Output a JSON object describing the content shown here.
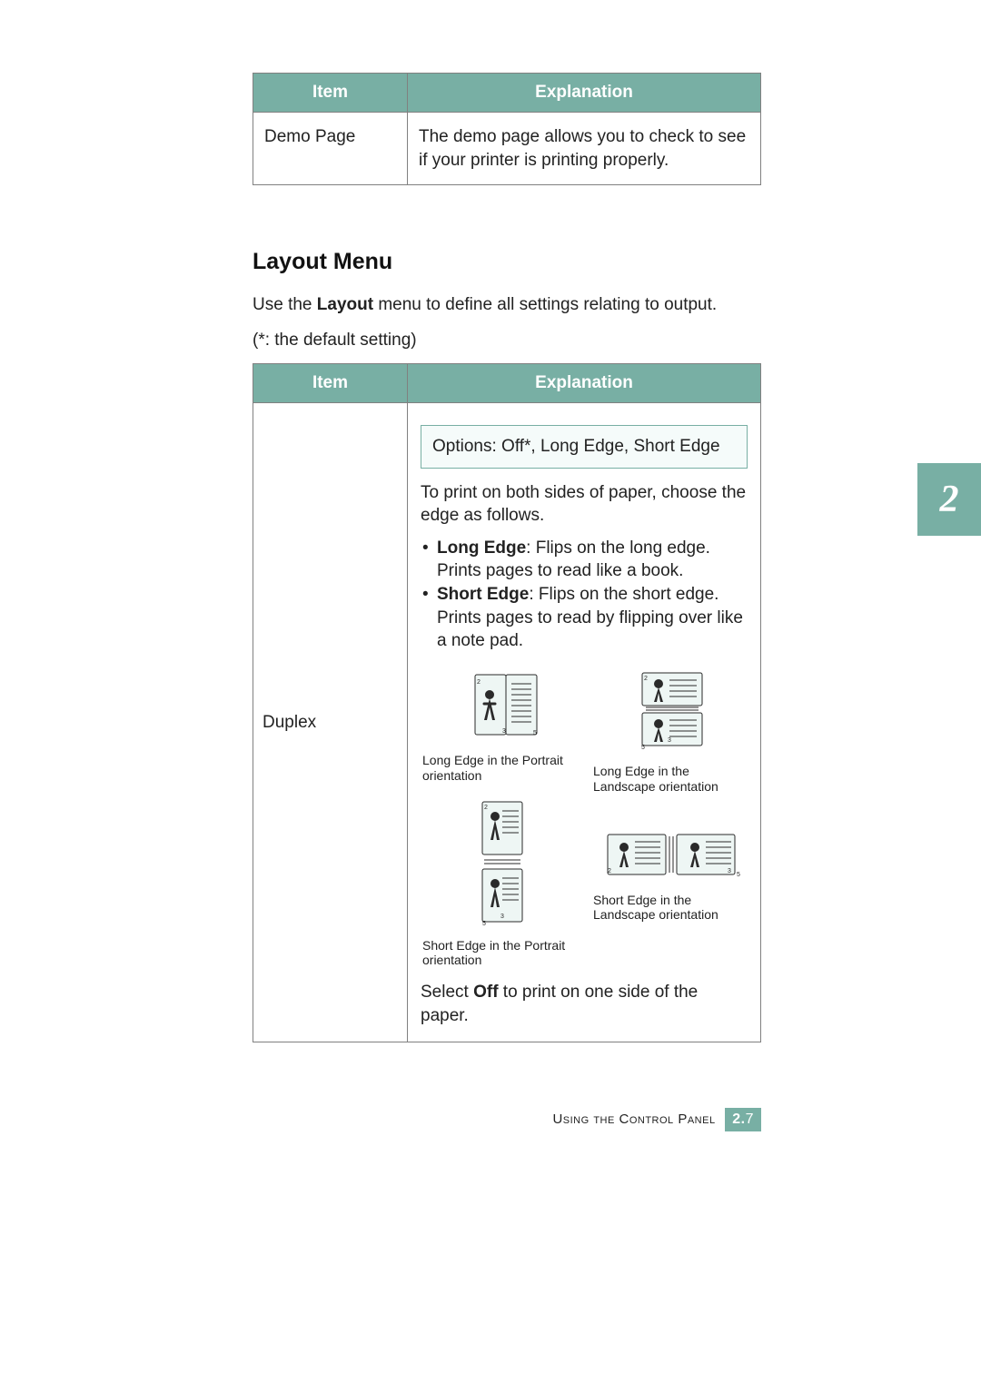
{
  "tables": {
    "top": {
      "headers": {
        "item": "Item",
        "explanation": "Explanation"
      },
      "row": {
        "item": "Demo Page",
        "explanation": "The demo page allows you to check to see if your printer is printing properly."
      }
    },
    "layout": {
      "heading": "Layout Menu",
      "intro_pre": "Use the ",
      "intro_bold": "Layout",
      "intro_post": " menu to define all settings relating to output.",
      "default_note": "(*: the default setting)",
      "headers": {
        "item": "Item",
        "explanation": "Explanation"
      },
      "row": {
        "item": "Duplex",
        "options_text": "Options: Off*, Long Edge, Short Edge",
        "explain_intro": "To print on both sides of paper, choose the edge as follows.",
        "bullets": {
          "long_bold": "Long Edge",
          "long_rest": ": Flips on the long edge. Prints pages to read like a book.",
          "short_bold": "Short Edge",
          "short_rest": ": Flips on the short edge. Prints pages to read by flipping over like a note pad."
        },
        "diagrams": {
          "lep": "Long Edge in the Portrait orientation",
          "lel": "Long Edge in the Landscape orientation",
          "sep": "Short Edge in the Portrait orientation",
          "sel": "Short Edge in the Landscape orientation"
        },
        "select_off_pre": "Select ",
        "select_off_bold": "Off",
        "select_off_post": " to print on one side of the paper."
      }
    }
  },
  "chapter_tab": "2",
  "footer": {
    "text": "Using the Control Panel",
    "chapter": "2.",
    "page": "7"
  }
}
